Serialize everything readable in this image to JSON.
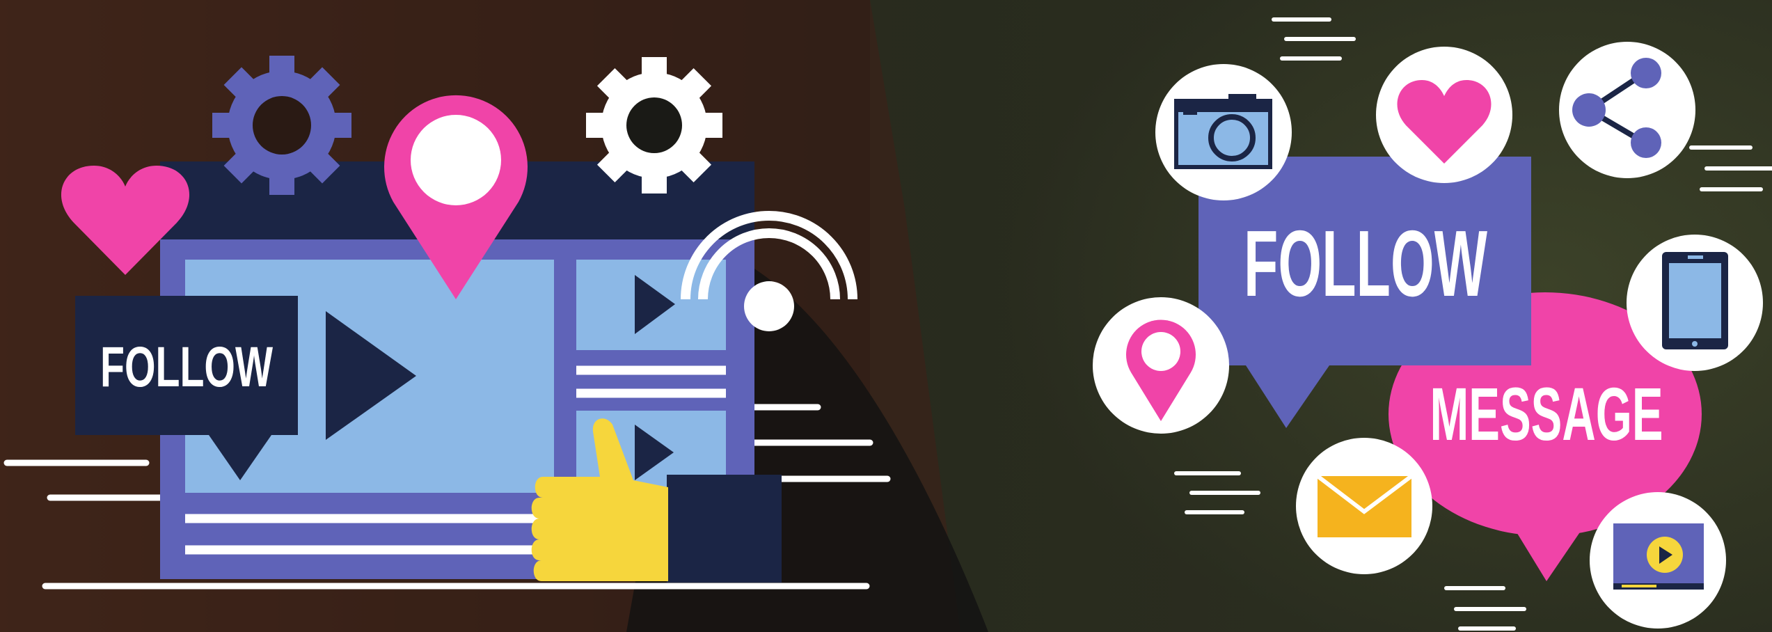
{
  "left_panel": {
    "follow_label": "FOLLOW"
  },
  "right_panel": {
    "follow_label": "FOLLOW",
    "message_label": "MESSAGE"
  },
  "icons": [
    "gear-icon",
    "map-pin-icon",
    "heart-icon",
    "play-icon",
    "wifi-signal-icon",
    "thumbs-up-icon",
    "camera-icon",
    "share-icon",
    "tablet-icon",
    "envelope-icon",
    "video-player-icon"
  ],
  "colors": {
    "navy": "#1b2545",
    "purple": "#5f63b8",
    "light_blue": "#8cb8e6",
    "pink": "#f044a8",
    "yellow": "#f6d63c",
    "white": "#ffffff",
    "envelope": "#f5b31e"
  }
}
